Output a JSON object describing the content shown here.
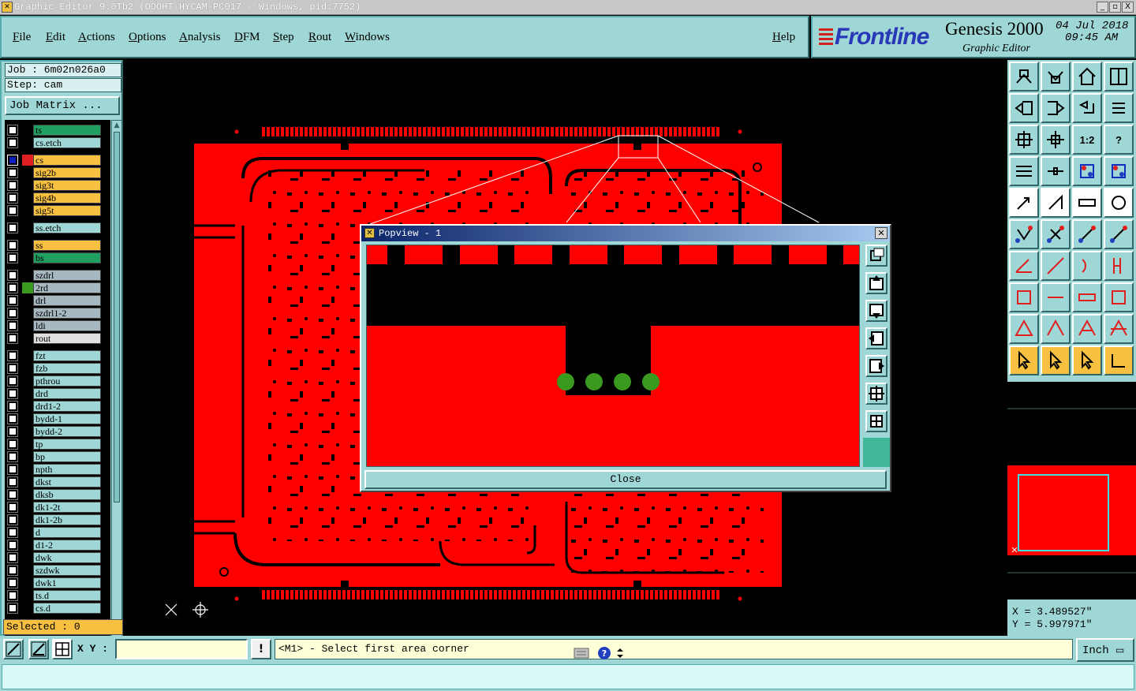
{
  "window": {
    "title": "Graphic Editor 9.0Tb2 (OOOHT-HYCAM-PC017 - Windows, pid:7752)",
    "controls": [
      "_",
      "▫",
      "X"
    ]
  },
  "menu": {
    "items": [
      "File",
      "Edit",
      "Actions",
      "Options",
      "Analysis",
      "DFM",
      "Step",
      "Rout",
      "Windows"
    ],
    "help": "Help"
  },
  "brand": {
    "logo": "Frontline",
    "product": "Genesis 2000",
    "subtitle": "Graphic Editor",
    "date": "04 Jul 2018",
    "time": "09:45 AM"
  },
  "job": {
    "job_line": "Job : 6m02n026a0",
    "step_line": "Step: cam",
    "job_matrix_label": "Job Matrix ..."
  },
  "layers": [
    {
      "name": "ts",
      "color": "#20a060",
      "swatch": "#000",
      "group": 0
    },
    {
      "name": "cs.etch",
      "color": "#9fd6d6",
      "swatch": "#000",
      "group": 0
    },
    {
      "name": "cs",
      "color": "#f8c040",
      "swatch": "#e02020",
      "group": 1,
      "active": true
    },
    {
      "name": "sig2b",
      "color": "#f8c040",
      "swatch": "#000",
      "group": 1
    },
    {
      "name": "sig3t",
      "color": "#f8c040",
      "swatch": "#000",
      "group": 1
    },
    {
      "name": "sig4b",
      "color": "#f8c040",
      "swatch": "#000",
      "group": 1
    },
    {
      "name": "sig5t",
      "color": "#f8c040",
      "swatch": "#000",
      "group": 1
    },
    {
      "name": "ss.etch",
      "color": "#9fd6d6",
      "swatch": "#000",
      "group": 2
    },
    {
      "name": "ss",
      "color": "#f8c040",
      "swatch": "#000",
      "group": 3
    },
    {
      "name": "bs",
      "color": "#20a060",
      "swatch": "#000",
      "group": 3
    },
    {
      "name": "szdrl",
      "color": "#a8b8c0",
      "swatch": "#000",
      "group": 4
    },
    {
      "name": "2rd",
      "color": "#a8b8c0",
      "swatch": "#3a9a20",
      "group": 4
    },
    {
      "name": "drl",
      "color": "#a8b8c0",
      "swatch": "#000",
      "group": 4
    },
    {
      "name": "szdrl1-2",
      "color": "#a8b8c0",
      "swatch": "#000",
      "group": 4
    },
    {
      "name": "ldi",
      "color": "#a8b8c0",
      "swatch": "#000",
      "group": 4
    },
    {
      "name": "rout",
      "color": "#e0e0e0",
      "swatch": "#000",
      "group": 4
    },
    {
      "name": "fzt",
      "color": "#9fd6d6",
      "swatch": "#000",
      "group": 5
    },
    {
      "name": "fzb",
      "color": "#9fd6d6",
      "swatch": "#000",
      "group": 5
    },
    {
      "name": "pthrou",
      "color": "#9fd6d6",
      "swatch": "#000",
      "group": 5
    },
    {
      "name": "drd",
      "color": "#9fd6d6",
      "swatch": "#000",
      "group": 5
    },
    {
      "name": "drd1-2",
      "color": "#9fd6d6",
      "swatch": "#000",
      "group": 5
    },
    {
      "name": "bydd-1",
      "color": "#9fd6d6",
      "swatch": "#000",
      "group": 5
    },
    {
      "name": "bydd-2",
      "color": "#9fd6d6",
      "swatch": "#000",
      "group": 5
    },
    {
      "name": "tp",
      "color": "#9fd6d6",
      "swatch": "#000",
      "group": 5
    },
    {
      "name": "bp",
      "color": "#9fd6d6",
      "swatch": "#000",
      "group": 5
    },
    {
      "name": "npth",
      "color": "#9fd6d6",
      "swatch": "#000",
      "group": 5
    },
    {
      "name": "dkst",
      "color": "#9fd6d6",
      "swatch": "#000",
      "group": 5
    },
    {
      "name": "dksb",
      "color": "#9fd6d6",
      "swatch": "#000",
      "group": 5
    },
    {
      "name": "dk1-2t",
      "color": "#9fd6d6",
      "swatch": "#000",
      "group": 5
    },
    {
      "name": "dk1-2b",
      "color": "#9fd6d6",
      "swatch": "#000",
      "group": 5
    },
    {
      "name": "d",
      "color": "#9fd6d6",
      "swatch": "#000",
      "group": 5
    },
    {
      "name": "d1-2",
      "color": "#9fd6d6",
      "swatch": "#000",
      "group": 5
    },
    {
      "name": "dwk",
      "color": "#9fd6d6",
      "swatch": "#000",
      "group": 5
    },
    {
      "name": "szdwk",
      "color": "#9fd6d6",
      "swatch": "#000",
      "group": 5
    },
    {
      "name": "dwk1",
      "color": "#9fd6d6",
      "swatch": "#000",
      "group": 5
    },
    {
      "name": "ts.d",
      "color": "#9fd6d6",
      "swatch": "#000",
      "group": 5
    },
    {
      "name": "cs.d",
      "color": "#9fd6d6",
      "swatch": "#000",
      "group": 5
    }
  ],
  "selected": "Selected : 0",
  "popview": {
    "title": "Popview - 1",
    "close_label": "Close"
  },
  "coords": {
    "x": "X = 3.489527\"",
    "y": "Y = 5.997971\""
  },
  "bottom": {
    "xy_label": "X Y :",
    "xy_value": "",
    "warn": "!",
    "status": "<M1> - Select first area corner",
    "units": "Inch"
  },
  "colors": {
    "copper": "#ff0000",
    "background": "#000000",
    "panel": "#9fd6d6",
    "drill": "#3a9a20",
    "highlight": "#f8c040"
  }
}
